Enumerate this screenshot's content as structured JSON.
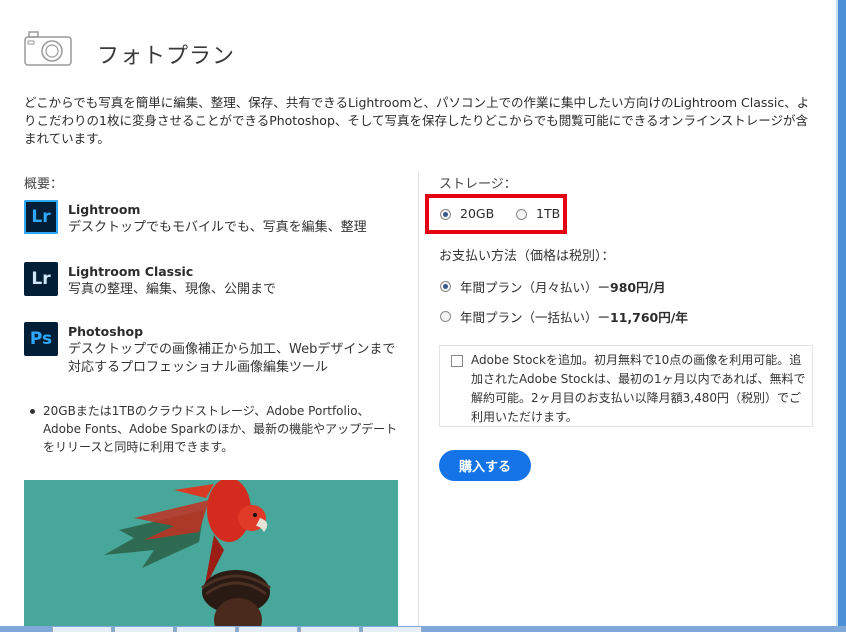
{
  "header": {
    "title": "フォトプラン",
    "intro": "どこからでも写真を簡単に編集、整理、保存、共有できるLightroomと、パソコン上での作業に集中したい方向けのLightroom Classic、よりこだわりの1枚に変身させることができるPhotoshop、そして写真を保存したりどこからでも閲覧可能にできるオンラインストレージが含まれています。"
  },
  "overview": {
    "label": "概要：",
    "apps": [
      {
        "icon": "Lr",
        "name": "Lightroom",
        "desc": "デスクトップでもモバイルでも、写真を編集、整理"
      },
      {
        "icon": "Lr",
        "name": "Lightroom Classic",
        "desc": "写真の整理、編集、現像、公開まで"
      },
      {
        "icon": "Ps",
        "name": "Photoshop",
        "desc": "デスクトップでの画像補正から加工、Webデザインまで対応するプロフェッショナル画像編集ツール"
      }
    ],
    "bullet": "20GBまたは1TBのクラウドストレージ、Adobe Portfolio、Adobe Fonts、Adobe Sparkのほか、最新の機能やアップデートをリリースと同時に利用できます。"
  },
  "storage": {
    "label": "ストレージ：",
    "options": [
      {
        "label": "20GB",
        "selected": true
      },
      {
        "label": "1TB",
        "selected": false
      }
    ]
  },
  "payment": {
    "label": "お支払い方法（価格は税別）：",
    "options": [
      {
        "label": "年間プラン（月々払い）ー",
        "price": "980円/月",
        "selected": true
      },
      {
        "label": "年間プラン（一括払い）ー",
        "price": "11,760円/年",
        "selected": false
      }
    ]
  },
  "stock": {
    "checked": false,
    "text": "Adobe Stockを追加。初月無料で10点の画像を利用可能。追加されたAdobe Stockは、最初の1ヶ月以内であれば、無料で解約可能。2ヶ月目のお支払い以降月額3,480円（税別）でご利用いただけます。"
  },
  "buy_button": "購入する",
  "colors": {
    "accent": "#1473e6",
    "highlight": "#e50012",
    "photo_bg": "#4eaea0"
  }
}
